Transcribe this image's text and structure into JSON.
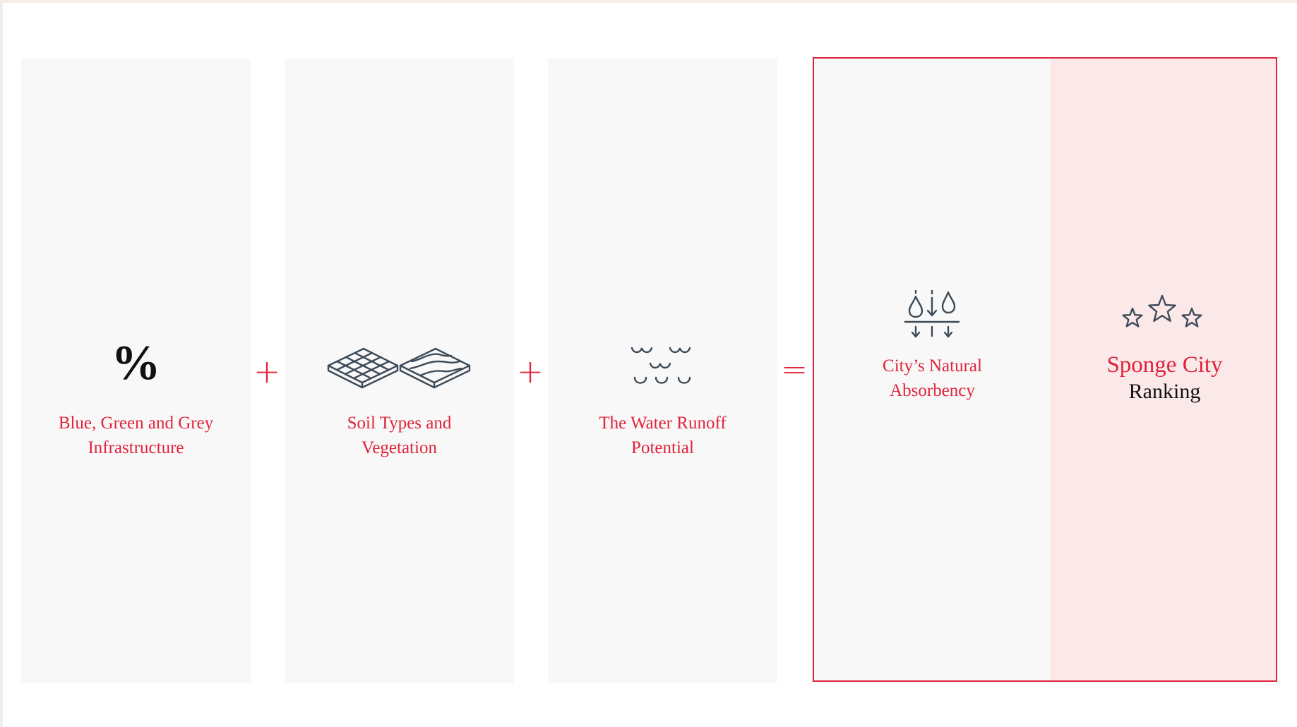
{
  "steps": [
    {
      "icon": "percent-icon",
      "glyph": "%",
      "label_lines": [
        "Blue, Green and Grey",
        "Infrastructure"
      ]
    },
    {
      "icon": "soil-tiles-icon",
      "label_lines": [
        "Soil Types and",
        "Vegetation"
      ]
    },
    {
      "icon": "water-waves-icon",
      "label_lines": [
        "The Water Runoff",
        "Potential"
      ]
    }
  ],
  "operators": [
    "+",
    "+",
    "="
  ],
  "result": {
    "absorbency": {
      "icon": "absorbency-drops-icon",
      "label_lines": [
        "City’s Natural",
        "Absorbency"
      ]
    },
    "ranking": {
      "icon": "three-stars-icon",
      "title": "Sponge City",
      "subtitle": "Ranking"
    }
  },
  "colors": {
    "accent": "#e0233a",
    "panel": "#f8f8f8",
    "highlight": "#fbe8e9",
    "icon": "#3d4a57"
  }
}
